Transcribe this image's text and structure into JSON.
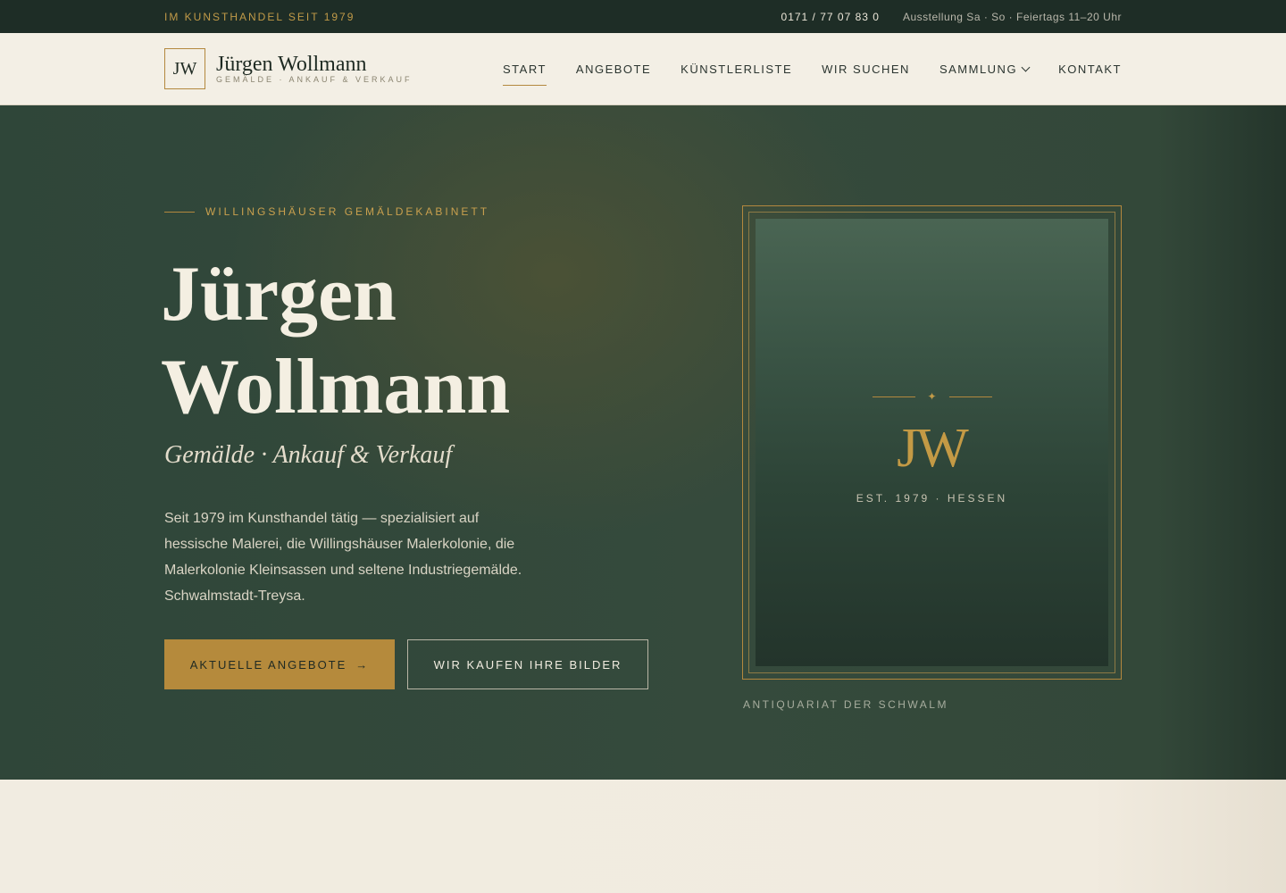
{
  "topbar": {
    "tagline": "IM KUNSTHANDEL SEIT 1979",
    "phone": "0171 / 77 07 83 0",
    "hours": "Ausstellung Sa · So · Feiertags 11–20 Uhr"
  },
  "header": {
    "logo_monogram": "JW",
    "brand_name": "Jürgen Wollmann",
    "brand_sub": "GEMÄLDE · ANKAUF & VERKAUF",
    "nav": [
      {
        "label": "START",
        "active": true
      },
      {
        "label": "ANGEBOTE"
      },
      {
        "label": "KÜNSTLERLISTE"
      },
      {
        "label": "WIR SUCHEN"
      },
      {
        "label": "SAMMLUNG",
        "icon": "chevron-down-icon"
      },
      {
        "label": "KONTAKT"
      }
    ]
  },
  "hero": {
    "eyebrow": "WILLINGSHÄUSER GEMÄLDEKABINETT",
    "title_line1": "Jürgen",
    "title_line2": "Wollmann",
    "subtitle": "Gemälde · Ankauf & Verkauf",
    "description": "Seit 1979 im Kunsthandel tätig — spezialisiert auf hessische Malerei, die Willingshäuser Malerkolonie, die Malerkolonie Kleinsassen und seltene Industriegemälde. Schwalmstadt-Treysa.",
    "primary_button": "AKTUELLE ANGEBOTE",
    "primary_button_icon": "arrow-right-icon",
    "secondary_button": "WIR KAUFEN IHRE BILDER",
    "frame_monogram": "JW",
    "frame_est": "EST. 1979 · HESSEN",
    "frame_ornament": "✦",
    "caption": "ANTIQUARIAT DER SCHWALM"
  },
  "colors": {
    "accent_gold": "#b58a3c",
    "hero_green": "#344a3c",
    "topbar": "#1e2d26",
    "cream": "#f3efe5"
  }
}
